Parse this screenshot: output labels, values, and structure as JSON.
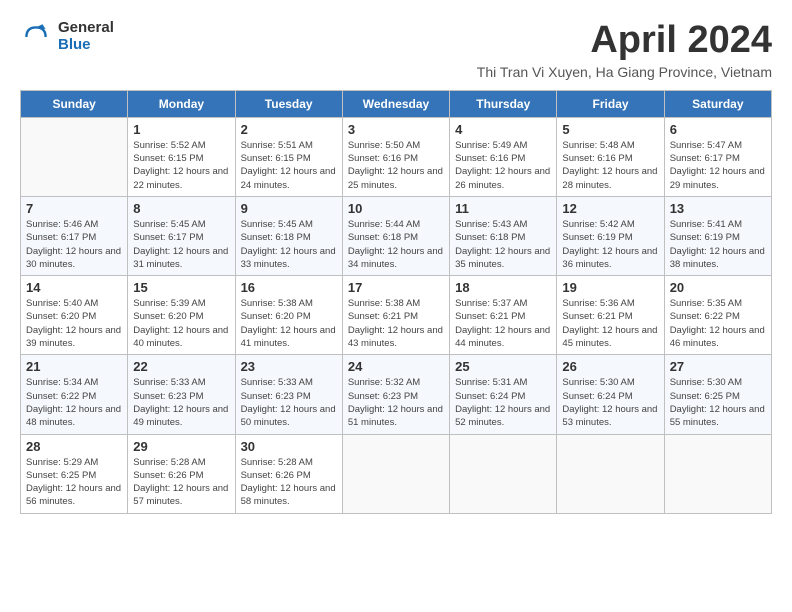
{
  "logo": {
    "general": "General",
    "blue": "Blue"
  },
  "header": {
    "title": "April 2024",
    "location": "Thi Tran Vi Xuyen, Ha Giang Province, Vietnam"
  },
  "weekdays": [
    "Sunday",
    "Monday",
    "Tuesday",
    "Wednesday",
    "Thursday",
    "Friday",
    "Saturday"
  ],
  "weeks": [
    [
      {
        "day": "",
        "sunrise": "",
        "sunset": "",
        "daylight": ""
      },
      {
        "day": "1",
        "sunrise": "Sunrise: 5:52 AM",
        "sunset": "Sunset: 6:15 PM",
        "daylight": "Daylight: 12 hours and 22 minutes."
      },
      {
        "day": "2",
        "sunrise": "Sunrise: 5:51 AM",
        "sunset": "Sunset: 6:15 PM",
        "daylight": "Daylight: 12 hours and 24 minutes."
      },
      {
        "day": "3",
        "sunrise": "Sunrise: 5:50 AM",
        "sunset": "Sunset: 6:16 PM",
        "daylight": "Daylight: 12 hours and 25 minutes."
      },
      {
        "day": "4",
        "sunrise": "Sunrise: 5:49 AM",
        "sunset": "Sunset: 6:16 PM",
        "daylight": "Daylight: 12 hours and 26 minutes."
      },
      {
        "day": "5",
        "sunrise": "Sunrise: 5:48 AM",
        "sunset": "Sunset: 6:16 PM",
        "daylight": "Daylight: 12 hours and 28 minutes."
      },
      {
        "day": "6",
        "sunrise": "Sunrise: 5:47 AM",
        "sunset": "Sunset: 6:17 PM",
        "daylight": "Daylight: 12 hours and 29 minutes."
      }
    ],
    [
      {
        "day": "7",
        "sunrise": "Sunrise: 5:46 AM",
        "sunset": "Sunset: 6:17 PM",
        "daylight": "Daylight: 12 hours and 30 minutes."
      },
      {
        "day": "8",
        "sunrise": "Sunrise: 5:45 AM",
        "sunset": "Sunset: 6:17 PM",
        "daylight": "Daylight: 12 hours and 31 minutes."
      },
      {
        "day": "9",
        "sunrise": "Sunrise: 5:45 AM",
        "sunset": "Sunset: 6:18 PM",
        "daylight": "Daylight: 12 hours and 33 minutes."
      },
      {
        "day": "10",
        "sunrise": "Sunrise: 5:44 AM",
        "sunset": "Sunset: 6:18 PM",
        "daylight": "Daylight: 12 hours and 34 minutes."
      },
      {
        "day": "11",
        "sunrise": "Sunrise: 5:43 AM",
        "sunset": "Sunset: 6:18 PM",
        "daylight": "Daylight: 12 hours and 35 minutes."
      },
      {
        "day": "12",
        "sunrise": "Sunrise: 5:42 AM",
        "sunset": "Sunset: 6:19 PM",
        "daylight": "Daylight: 12 hours and 36 minutes."
      },
      {
        "day": "13",
        "sunrise": "Sunrise: 5:41 AM",
        "sunset": "Sunset: 6:19 PM",
        "daylight": "Daylight: 12 hours and 38 minutes."
      }
    ],
    [
      {
        "day": "14",
        "sunrise": "Sunrise: 5:40 AM",
        "sunset": "Sunset: 6:20 PM",
        "daylight": "Daylight: 12 hours and 39 minutes."
      },
      {
        "day": "15",
        "sunrise": "Sunrise: 5:39 AM",
        "sunset": "Sunset: 6:20 PM",
        "daylight": "Daylight: 12 hours and 40 minutes."
      },
      {
        "day": "16",
        "sunrise": "Sunrise: 5:38 AM",
        "sunset": "Sunset: 6:20 PM",
        "daylight": "Daylight: 12 hours and 41 minutes."
      },
      {
        "day": "17",
        "sunrise": "Sunrise: 5:38 AM",
        "sunset": "Sunset: 6:21 PM",
        "daylight": "Daylight: 12 hours and 43 minutes."
      },
      {
        "day": "18",
        "sunrise": "Sunrise: 5:37 AM",
        "sunset": "Sunset: 6:21 PM",
        "daylight": "Daylight: 12 hours and 44 minutes."
      },
      {
        "day": "19",
        "sunrise": "Sunrise: 5:36 AM",
        "sunset": "Sunset: 6:21 PM",
        "daylight": "Daylight: 12 hours and 45 minutes."
      },
      {
        "day": "20",
        "sunrise": "Sunrise: 5:35 AM",
        "sunset": "Sunset: 6:22 PM",
        "daylight": "Daylight: 12 hours and 46 minutes."
      }
    ],
    [
      {
        "day": "21",
        "sunrise": "Sunrise: 5:34 AM",
        "sunset": "Sunset: 6:22 PM",
        "daylight": "Daylight: 12 hours and 48 minutes."
      },
      {
        "day": "22",
        "sunrise": "Sunrise: 5:33 AM",
        "sunset": "Sunset: 6:23 PM",
        "daylight": "Daylight: 12 hours and 49 minutes."
      },
      {
        "day": "23",
        "sunrise": "Sunrise: 5:33 AM",
        "sunset": "Sunset: 6:23 PM",
        "daylight": "Daylight: 12 hours and 50 minutes."
      },
      {
        "day": "24",
        "sunrise": "Sunrise: 5:32 AM",
        "sunset": "Sunset: 6:23 PM",
        "daylight": "Daylight: 12 hours and 51 minutes."
      },
      {
        "day": "25",
        "sunrise": "Sunrise: 5:31 AM",
        "sunset": "Sunset: 6:24 PM",
        "daylight": "Daylight: 12 hours and 52 minutes."
      },
      {
        "day": "26",
        "sunrise": "Sunrise: 5:30 AM",
        "sunset": "Sunset: 6:24 PM",
        "daylight": "Daylight: 12 hours and 53 minutes."
      },
      {
        "day": "27",
        "sunrise": "Sunrise: 5:30 AM",
        "sunset": "Sunset: 6:25 PM",
        "daylight": "Daylight: 12 hours and 55 minutes."
      }
    ],
    [
      {
        "day": "28",
        "sunrise": "Sunrise: 5:29 AM",
        "sunset": "Sunset: 6:25 PM",
        "daylight": "Daylight: 12 hours and 56 minutes."
      },
      {
        "day": "29",
        "sunrise": "Sunrise: 5:28 AM",
        "sunset": "Sunset: 6:26 PM",
        "daylight": "Daylight: 12 hours and 57 minutes."
      },
      {
        "day": "30",
        "sunrise": "Sunrise: 5:28 AM",
        "sunset": "Sunset: 6:26 PM",
        "daylight": "Daylight: 12 hours and 58 minutes."
      },
      {
        "day": "",
        "sunrise": "",
        "sunset": "",
        "daylight": ""
      },
      {
        "day": "",
        "sunrise": "",
        "sunset": "",
        "daylight": ""
      },
      {
        "day": "",
        "sunrise": "",
        "sunset": "",
        "daylight": ""
      },
      {
        "day": "",
        "sunrise": "",
        "sunset": "",
        "daylight": ""
      }
    ]
  ]
}
